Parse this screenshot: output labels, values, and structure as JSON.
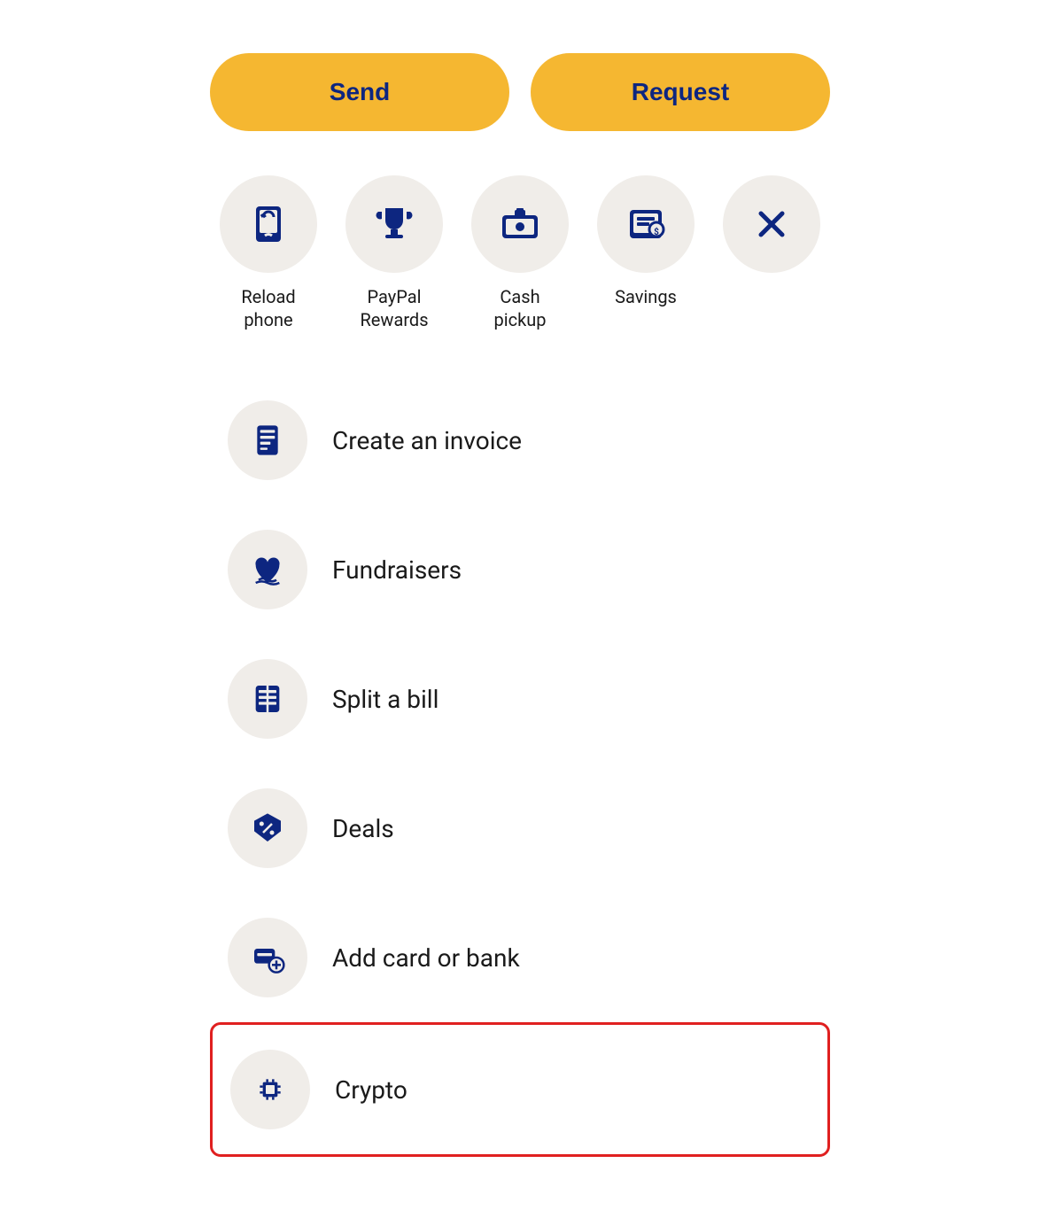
{
  "buttons": {
    "send_label": "Send",
    "request_label": "Request"
  },
  "quick_actions": [
    {
      "id": "reload-phone",
      "label": "Reload\nphone",
      "icon": "reload-phone-icon"
    },
    {
      "id": "paypal-rewards",
      "label": "PayPal\nRewards",
      "icon": "trophy-icon"
    },
    {
      "id": "cash-pickup",
      "label": "Cash\npickup",
      "icon": "cash-pickup-icon"
    },
    {
      "id": "savings",
      "label": "Savings",
      "icon": "savings-icon"
    },
    {
      "id": "close",
      "label": "",
      "icon": "close-icon"
    }
  ],
  "list_items": [
    {
      "id": "create-invoice",
      "label": "Create an invoice",
      "icon": "invoice-icon"
    },
    {
      "id": "fundraisers",
      "label": "Fundraisers",
      "icon": "fundraisers-icon"
    },
    {
      "id": "split-bill",
      "label": "Split a bill",
      "icon": "split-bill-icon"
    },
    {
      "id": "deals",
      "label": "Deals",
      "icon": "deals-icon"
    },
    {
      "id": "add-card-bank",
      "label": "Add card or bank",
      "icon": "add-card-icon"
    },
    {
      "id": "crypto",
      "label": "Crypto",
      "icon": "crypto-icon",
      "highlighted": true
    }
  ],
  "colors": {
    "brand_yellow": "#F5B731",
    "brand_blue": "#0d2680",
    "icon_bg": "#f0ede9",
    "highlight_border": "#e02020"
  }
}
